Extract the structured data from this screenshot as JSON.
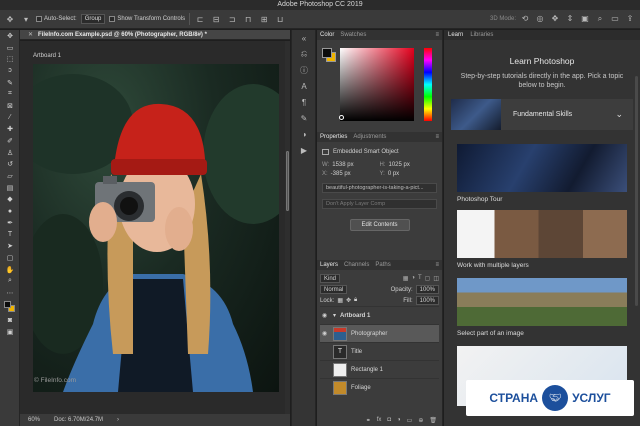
{
  "window": {
    "title": "Adobe Photoshop CC 2019"
  },
  "options_bar": {
    "auto_select_label": "Auto-Select:",
    "auto_select_value": "Group",
    "transform_label": "Show Transform Controls",
    "mode_label": "3D Mode:"
  },
  "document": {
    "tab_title": "FileInfo.com Example.psd @ 60% (Photographer, RGB/8#) *",
    "artboard_label": "Artboard 1",
    "watermark": "© FileInfo.com"
  },
  "status": {
    "zoom": "60%",
    "doc_size": "Doc: 6.70M/24.7M"
  },
  "color_panel": {
    "tab_color": "Color",
    "tab_swatches": "Swatches"
  },
  "properties_panel": {
    "tab_properties": "Properties",
    "tab_adjustments": "Adjustments",
    "type_label": "Embedded Smart Object",
    "w_label": "W:",
    "w_value": "1538 px",
    "h_label": "H:",
    "h_value": "1025 px",
    "x_label": "X:",
    "x_value": "-385 px",
    "y_label": "Y:",
    "y_value": "0 px",
    "file_name": "beautiful-photographer-is-taking-a-pict...",
    "comp_placeholder": "Don't Apply Layer Comp",
    "edit_button": "Edit Contents"
  },
  "layers_panel": {
    "tabs": [
      "Layers",
      "Channels",
      "Paths"
    ],
    "kind_label": "Kind",
    "blend_mode": "Normal",
    "opacity_label": "Opacity:",
    "opacity_value": "100%",
    "lock_label": "Lock:",
    "fill_label": "Fill:",
    "fill_value": "100%",
    "layers": [
      {
        "name": "Artboard 1"
      },
      {
        "name": "Photographer"
      },
      {
        "name": "Title"
      },
      {
        "name": "Rectangle 1"
      },
      {
        "name": "Foliage"
      }
    ]
  },
  "learn_panel": {
    "tab_learn": "Learn",
    "tab_libraries": "Libraries",
    "title": "Learn Photoshop",
    "subtitle": "Step-by-step tutorials directly in the app. Pick a topic below to begin.",
    "section_label": "Fundamental Skills",
    "tutorials": [
      {
        "label": "Photoshop Tour"
      },
      {
        "label": "Work with multiple layers"
      },
      {
        "label": "Select part of an image"
      }
    ]
  },
  "overlay_logo": {
    "left_text": "СТРАНА",
    "right_text": "УСЛУГ"
  }
}
